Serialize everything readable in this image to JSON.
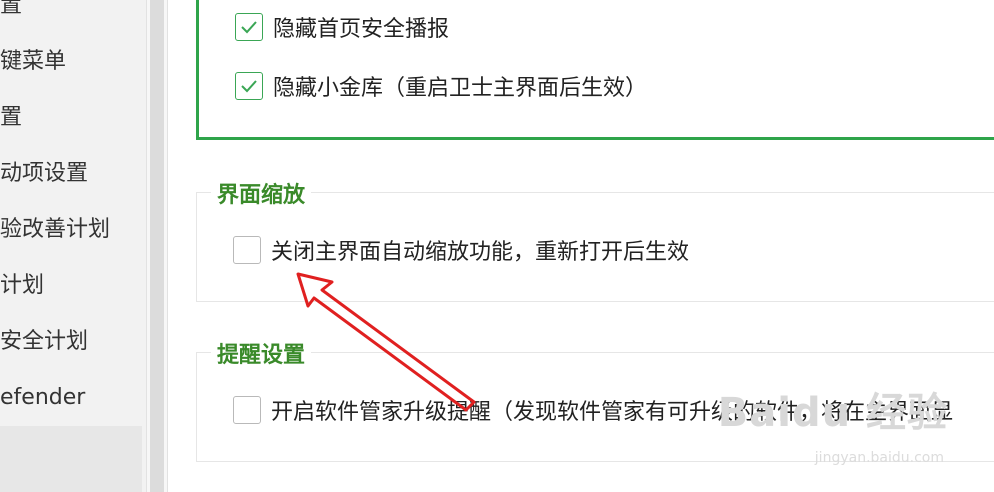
{
  "sidebar": {
    "items": [
      "置",
      "键菜单",
      "置",
      "动项设置",
      "验改善计划",
      "计划",
      "安全计划",
      "efender"
    ]
  },
  "main": {
    "top_group": {
      "options": [
        {
          "label": "隐藏首页安全播报",
          "checked": true
        },
        {
          "label": "隐藏小金库（重启卫士主界面后生效）",
          "checked": true
        }
      ]
    },
    "zoom_group": {
      "title": "界面缩放",
      "option": {
        "label": "关闭主界面自动缩放功能，重新打开后生效",
        "checked": false
      }
    },
    "reminder_group": {
      "title": "提醒设置",
      "option": {
        "label": "开启软件管家升级提醒（发现软件管家有可升级的软件，将在主界面显",
        "checked": false
      }
    }
  },
  "watermark": {
    "logo": "Baidu 经验",
    "url": "jingyan.baidu.com"
  },
  "colors": {
    "accent_green": "#2ea44a",
    "title_green": "#3a8a2a",
    "arrow_red": "#e02020"
  }
}
